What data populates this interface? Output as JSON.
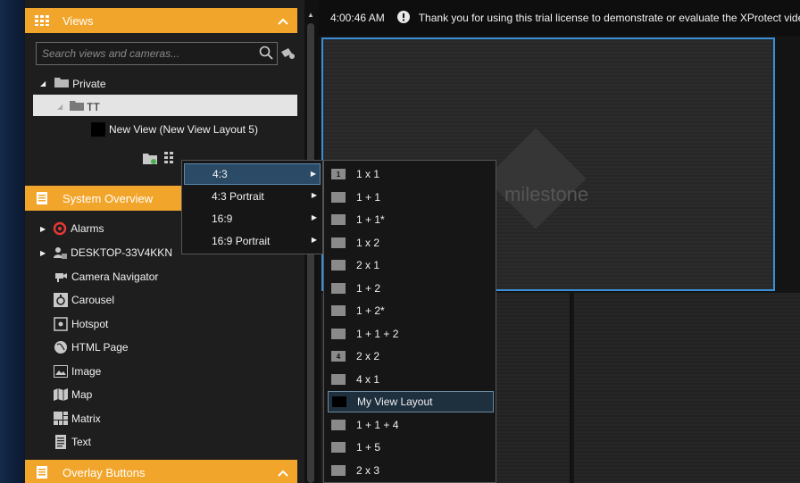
{
  "views_panel": {
    "title": "Views",
    "search_placeholder": "Search views and cameras...",
    "tree": {
      "root_label": "Private",
      "folder_label": "TT",
      "view_label": "New View (New View Layout 5)"
    }
  },
  "system_overview": {
    "title": "System Overview",
    "items": [
      {
        "label": "Alarms"
      },
      {
        "label": "DESKTOP-33V4KKN"
      },
      {
        "label": "Camera Navigator"
      },
      {
        "label": "Carousel"
      },
      {
        "label": "Hotspot"
      },
      {
        "label": "HTML Page"
      },
      {
        "label": "Image"
      },
      {
        "label": "Map"
      },
      {
        "label": "Matrix"
      },
      {
        "label": "Text"
      }
    ]
  },
  "overlay_buttons": {
    "title": "Overlay Buttons"
  },
  "topbar": {
    "time": "4:00:46 AM",
    "message": "Thank you for using this trial license to demonstrate or evaluate the XProtect video m"
  },
  "watermark": {
    "text": "milestone"
  },
  "aspect_menu": {
    "items": [
      {
        "label": "4:3"
      },
      {
        "label": "4:3 Portrait"
      },
      {
        "label": "16:9"
      },
      {
        "label": "16:9 Portrait"
      }
    ]
  },
  "layout_menu": {
    "items": [
      {
        "label": "1 x 1",
        "badge": "1"
      },
      {
        "label": "1 + 1",
        "badge": ""
      },
      {
        "label": "1 + 1*",
        "badge": ""
      },
      {
        "label": "1 x 2",
        "badge": ""
      },
      {
        "label": "2 x 1",
        "badge": ""
      },
      {
        "label": "1 + 2",
        "badge": ""
      },
      {
        "label": "1 + 2*",
        "badge": ""
      },
      {
        "label": "1 + 1 + 2",
        "badge": ""
      },
      {
        "label": "2 x 2",
        "badge": "4"
      },
      {
        "label": "4 x 1",
        "badge": ""
      },
      {
        "label": "My View Layout",
        "badge": ""
      },
      {
        "label": "1 + 1 + 4",
        "badge": ""
      },
      {
        "label": "1 + 5",
        "badge": ""
      },
      {
        "label": "2 x 3",
        "badge": ""
      }
    ]
  },
  "colors": {
    "panel_header": "#f2a52b",
    "selection_border": "#3a8fd6"
  }
}
